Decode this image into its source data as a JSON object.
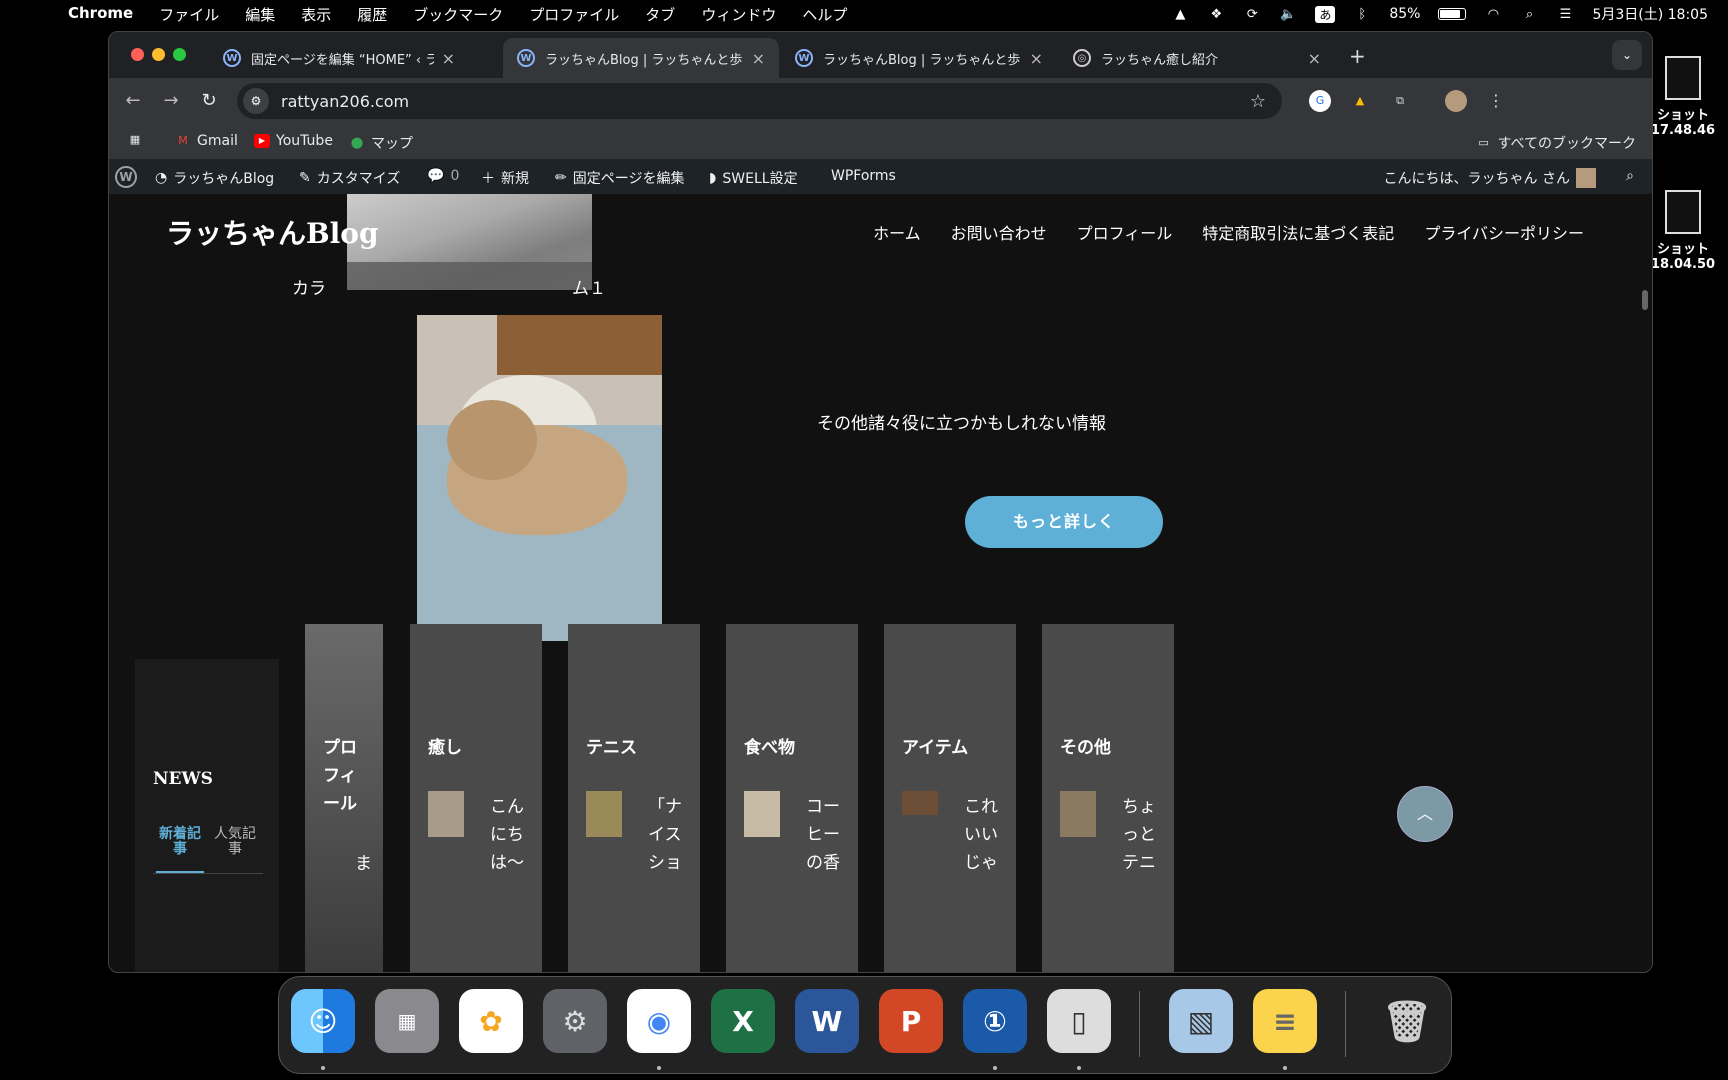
{
  "menubar": {
    "app": "Chrome",
    "items": [
      "ファイル",
      "編集",
      "表示",
      "履歴",
      "ブックマーク",
      "プロファイル",
      "タブ",
      "ウィンドウ",
      "ヘルプ"
    ],
    "ime": "あ",
    "battery": "85%",
    "datetime": "5月3日(土)  18:05"
  },
  "desktop": {
    "items": [
      {
        "label": "ショット",
        "sub": "17.48.46"
      },
      {
        "label": "ショット",
        "sub": "18.04.50"
      }
    ]
  },
  "tabs": [
    {
      "title": "固定ページを編集 “HOME” ‹ ラ",
      "active": false
    },
    {
      "title": "ラッちゃんBlog | ラッちゃんと歩",
      "active": true
    },
    {
      "title": "ラッちゃんBlog | ラッちゃんと歩",
      "active": false
    },
    {
      "title": "ラッちゃん癒し紹介",
      "active": false
    }
  ],
  "omnibox": {
    "url": "rattyan206.com"
  },
  "bookmarks": {
    "items": [
      "Gmail",
      "YouTube",
      "マップ"
    ],
    "all": "すべてのブックマーク"
  },
  "wpbar": {
    "site": "ラッちゃんBlog",
    "customize": "カスタマイズ",
    "comments": "0",
    "new": "新規",
    "edit": "固定ページを編集",
    "swell": "SWELL設定",
    "wpforms": "WPForms",
    "greeting": "こんにちは、ラッちゃん さん"
  },
  "site": {
    "title": "ラッちゃんBlog",
    "nav": [
      "ホーム",
      "お問い合わせ",
      "プロフィール",
      "特定商取引法に基づく表記",
      "プライバシーポリシー"
    ],
    "column_left": "カラ",
    "column_right": "ム１",
    "info": "その他諸々役に立つかもしれない情報",
    "more_button": "もっと詳しく",
    "news": {
      "title": "NEWS",
      "tab_new": "新着記事",
      "tab_popular": "人気記事"
    },
    "categories": [
      {
        "title": "プロフィール",
        "text": "ま"
      },
      {
        "title": "癒し",
        "text": "こんにちは〜"
      },
      {
        "title": "テニス",
        "text": "「ナイスショ"
      },
      {
        "title": "食べ物",
        "text": "コーヒーの香"
      },
      {
        "title": "アイテム",
        "text": "これいいじゃ"
      },
      {
        "title": "その他",
        "text": "ちょっとテニ"
      }
    ]
  },
  "colors": {
    "accent": "#5eb0d6",
    "wpbar": "#1d2327",
    "page_bg": "#111111"
  }
}
